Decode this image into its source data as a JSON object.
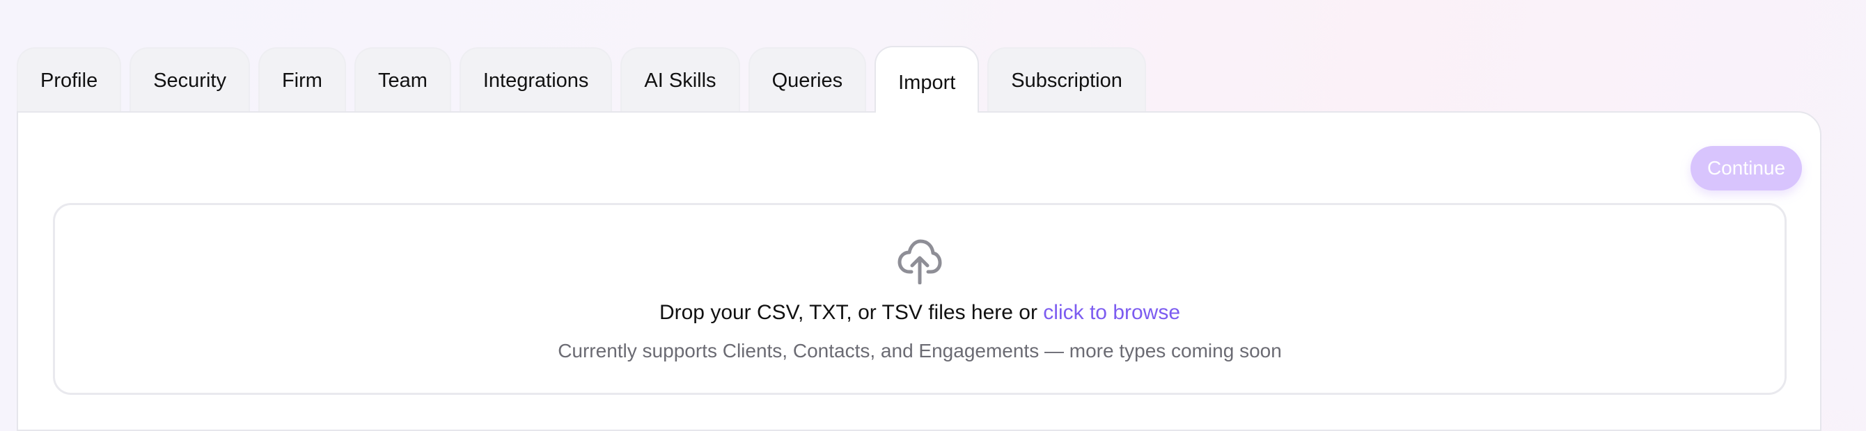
{
  "tabs": [
    {
      "label": "Profile"
    },
    {
      "label": "Security"
    },
    {
      "label": "Firm"
    },
    {
      "label": "Team"
    },
    {
      "label": "Integrations"
    },
    {
      "label": "AI Skills"
    },
    {
      "label": "Queries"
    },
    {
      "label": "Import",
      "active": true
    },
    {
      "label": "Subscription"
    }
  ],
  "import": {
    "continue_label": "Continue",
    "dropzone": {
      "icon": "cloud-upload-icon",
      "prompt_text": "Drop your CSV, TXT, or TSV files here or ",
      "browse_link": "click to browse",
      "supported_text": "Currently supports Clients, Contacts, and Engagements — more types coming soon"
    }
  },
  "colors": {
    "accent": "#7c5cf0",
    "continue_disabled_bg": "#d8c4fd",
    "icon_gray": "#8e8e96"
  }
}
